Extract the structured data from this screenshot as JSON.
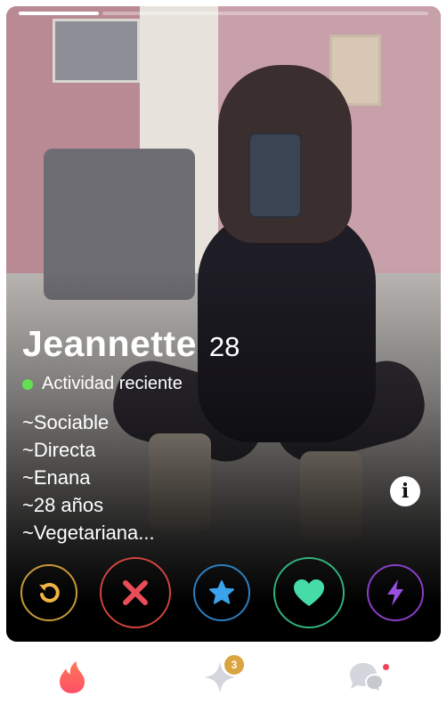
{
  "profile": {
    "name": "Jeannette",
    "age": "28",
    "activity": "Actividad reciente",
    "bio_lines": [
      "~Sociable",
      "~Directa",
      "~Enana",
      "~28 años",
      "~Vegetariana..."
    ],
    "photo_index": 1,
    "photo_count": 2
  },
  "icons": {
    "info": "i",
    "rewind": "rewind-icon",
    "nope": "x-icon",
    "superlike": "star-icon",
    "like": "heart-icon",
    "boost": "bolt-icon"
  },
  "tabbar": {
    "explore_badge": "3"
  },
  "colors": {
    "activity_dot": "#62e052",
    "rewind": "#f1b545",
    "nope": "#ea4c58",
    "superlike": "#3aa3ec",
    "like": "#46dca7",
    "boost": "#9b4ee4",
    "flame_start": "#fd5068",
    "flame_end": "#ff7854",
    "badge": "#d9a441"
  }
}
